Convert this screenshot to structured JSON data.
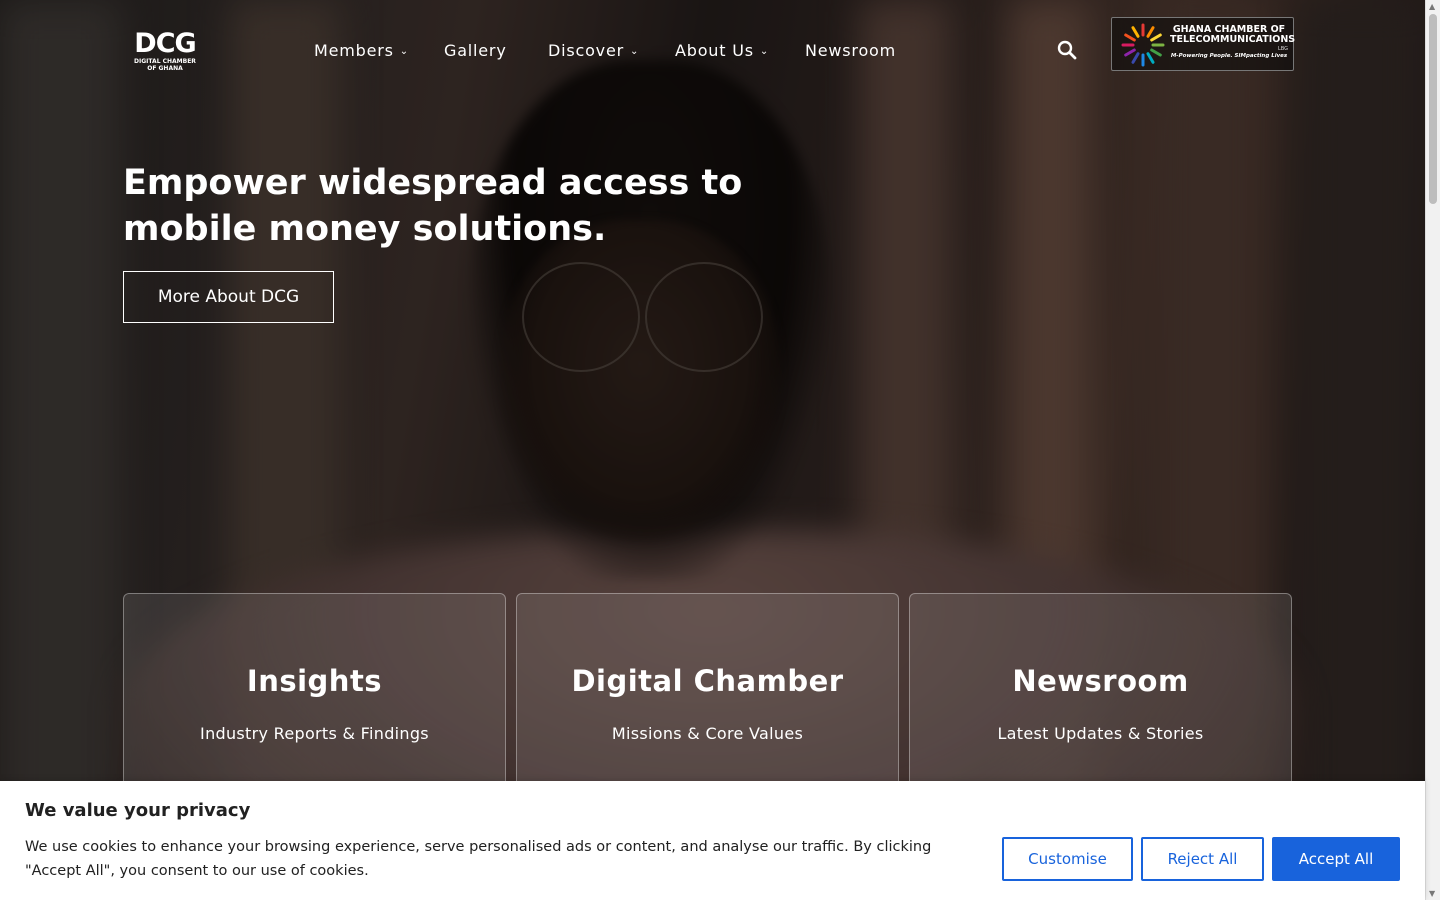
{
  "brand": {
    "logo_mark": "DCG",
    "logo_subtitle_line1": "DIGITAL CHAMBER",
    "logo_subtitle_line2": "OF GHANA"
  },
  "nav": {
    "items": [
      {
        "label": "Members",
        "has_dropdown": true
      },
      {
        "label": "Gallery",
        "has_dropdown": false
      },
      {
        "label": "Discover",
        "has_dropdown": true
      },
      {
        "label": "About Us",
        "has_dropdown": true
      },
      {
        "label": "Newsroom",
        "has_dropdown": false
      }
    ],
    "search_icon": "search-icon"
  },
  "partner": {
    "line1": "GHANA CHAMBER OF",
    "line2": "TELECOMMUNICATIONS",
    "suffix": "LBG",
    "tagline": "M-Powering People. SIMpacting Lives"
  },
  "hero": {
    "headline_line1": "Empower widespread access to",
    "headline_line2": "mobile money solutions.",
    "cta_label": "More About DCG"
  },
  "cards": [
    {
      "title": "Insights",
      "subtitle": "Industry Reports & Findings"
    },
    {
      "title": "Digital Chamber",
      "subtitle": "Missions & Core Values"
    },
    {
      "title": "Newsroom",
      "subtitle": "Latest Updates & Stories"
    }
  ],
  "cookie": {
    "title": "We value your privacy",
    "text": "We use cookies to enhance your browsing experience, serve personalised ads or content, and analyse our traffic. By clicking \"Accept All\", you consent to our use of cookies.",
    "customise_label": "Customise",
    "reject_label": "Reject All",
    "accept_label": "Accept All"
  },
  "colors": {
    "accent_blue": "#1863dc",
    "overlay": "#000000",
    "text_light": "#ffffff"
  }
}
